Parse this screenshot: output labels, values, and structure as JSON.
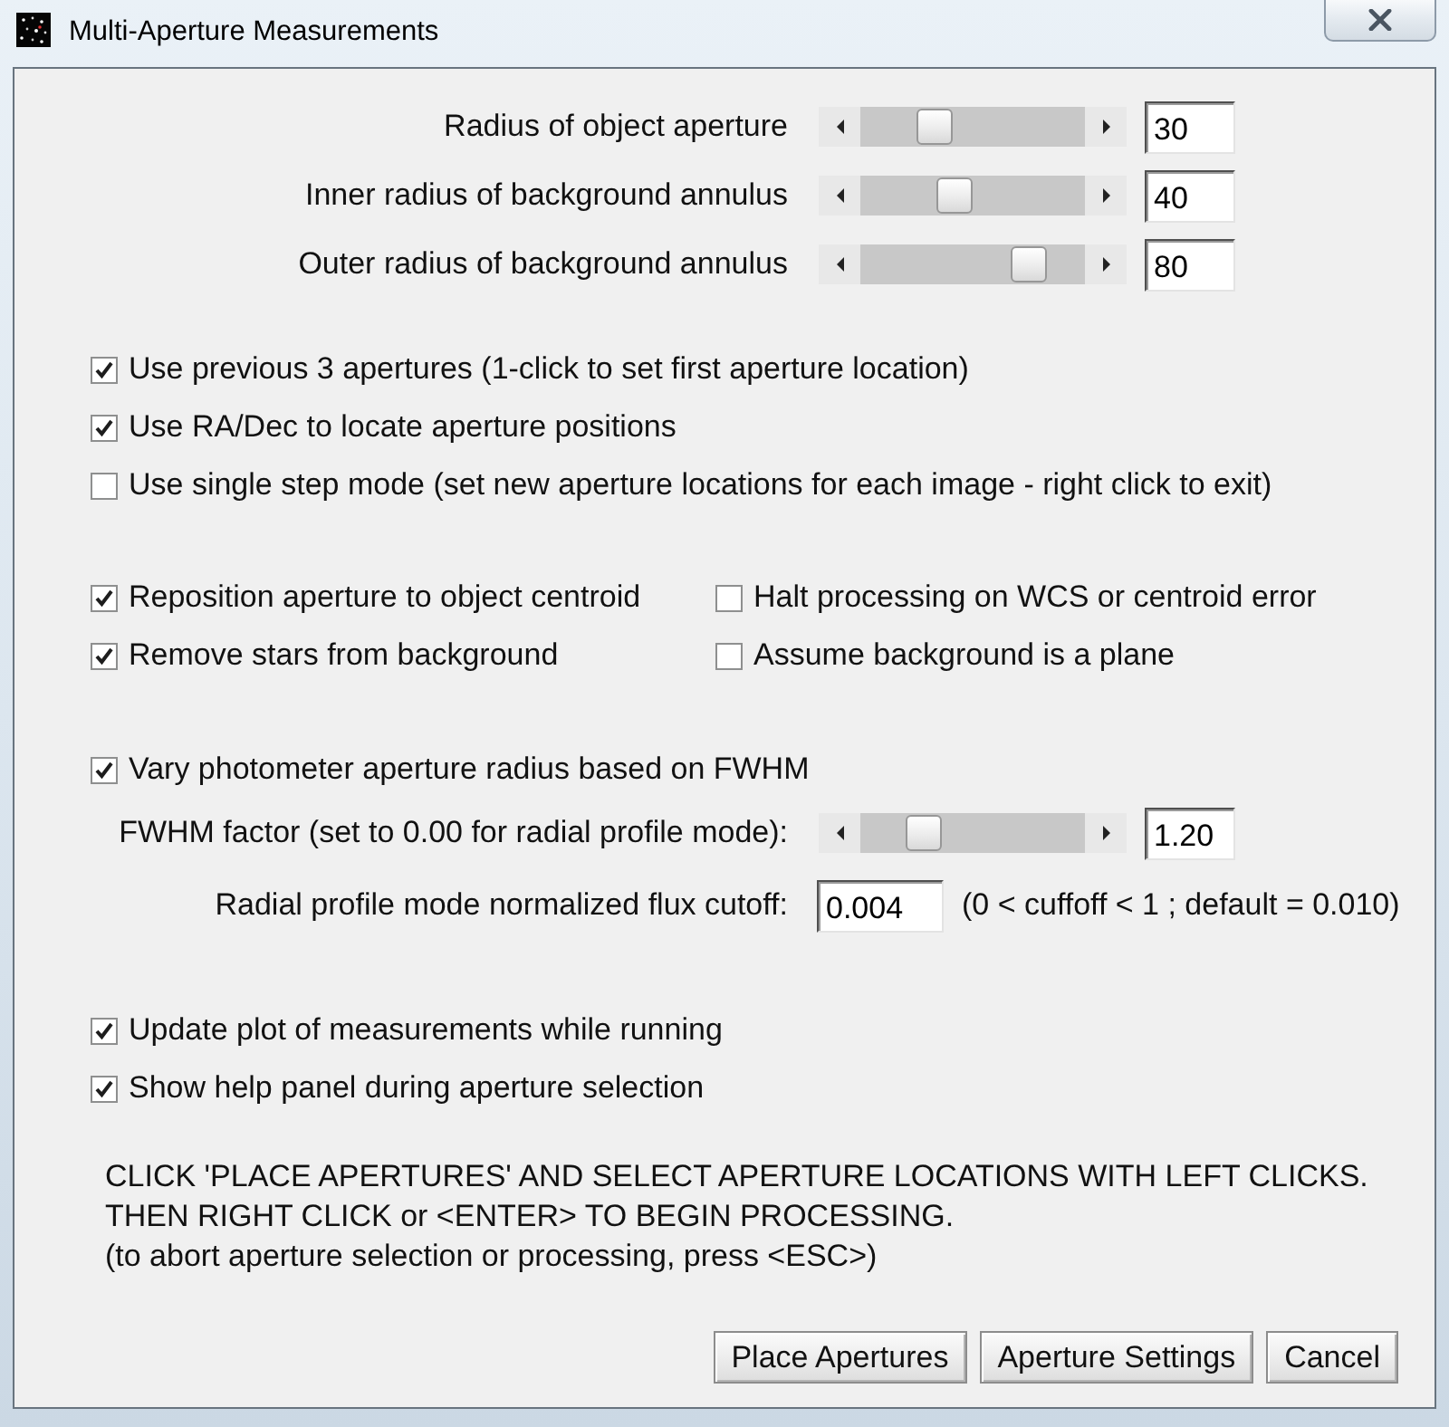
{
  "window": {
    "title": "Multi-Aperture Measurements"
  },
  "aperture_sliders": [
    {
      "label": "Radius of object aperture",
      "level": 0.3,
      "value": "30"
    },
    {
      "label": "Inner radius of background annulus",
      "level": 0.4,
      "value": "40"
    },
    {
      "label": "Outer radius of background annulus",
      "level": 0.8,
      "value": "80"
    }
  ],
  "location_options": [
    {
      "label": "Use previous 3 apertures (1-click to set first aperture location)",
      "checked": true
    },
    {
      "label": "Use RA/Dec to locate aperture positions",
      "checked": true
    },
    {
      "label": "Use single step mode (set new aperture locations for each image - right click to exit)",
      "checked": false
    }
  ],
  "centroid_options": [
    {
      "label": "Reposition aperture to object centroid",
      "checked": true
    },
    {
      "label": "Halt processing on WCS or centroid error",
      "checked": false
    },
    {
      "label": "Remove stars from background",
      "checked": true
    },
    {
      "label": "Assume background is a plane",
      "checked": false
    }
  ],
  "fwhm": {
    "vary": {
      "label": "Vary photometer aperture radius based on FWHM",
      "checked": true
    },
    "factor": {
      "label": "FWHM factor (set to 0.00 for radial profile mode):",
      "level": 0.24,
      "value": "1.20"
    },
    "cutoff": {
      "label": "Radial profile mode normalized flux cutoff:",
      "value": "0.004",
      "note": "(0 < cuffoff < 1 ; default = 0.010)"
    }
  },
  "plot_options": [
    {
      "label": "Update plot of measurements while running",
      "checked": true
    },
    {
      "label": "Show help panel during aperture selection",
      "checked": true
    }
  ],
  "instructions": [
    "CLICK 'PLACE APERTURES' AND SELECT APERTURE LOCATIONS WITH LEFT CLICKS.",
    "THEN RIGHT CLICK or <ENTER> TO BEGIN PROCESSING.",
    "(to abort aperture selection or processing, press <ESC>)"
  ],
  "buttons": [
    "Place Apertures",
    "Aperture Settings",
    "Cancel"
  ]
}
